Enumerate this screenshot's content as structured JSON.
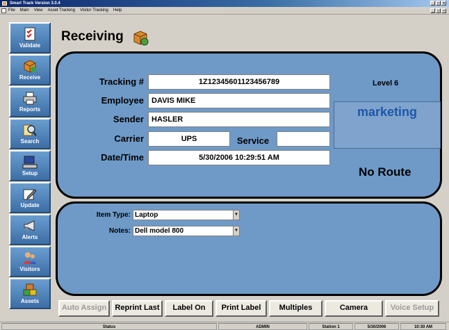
{
  "window": {
    "title": "Smart Track Version 3.0.4"
  },
  "menu": [
    "File",
    "Main",
    "View",
    "Asset Tracking",
    "Visitor Tracking",
    "Help"
  ],
  "window_controls": [
    "_",
    "□",
    "×"
  ],
  "sidebar": {
    "items": [
      {
        "label": "Validate",
        "icon": "checklist-icon"
      },
      {
        "label": "Receive",
        "icon": "package-icon"
      },
      {
        "label": "Reports",
        "icon": "printer-icon"
      },
      {
        "label": "Search",
        "icon": "magnifier-icon"
      },
      {
        "label": "Setup",
        "icon": "computer-icon"
      },
      {
        "label": "Update",
        "icon": "pencil-icon"
      },
      {
        "label": "Alerts",
        "icon": "megaphone-icon"
      },
      {
        "label": "Visitors",
        "icon": "people-icon"
      },
      {
        "label": "Assets",
        "icon": "boxes-icon"
      }
    ]
  },
  "page": {
    "title": "Receiving"
  },
  "form": {
    "tracking_label": "Tracking #",
    "tracking_value": "1Z12345601123456789",
    "employee_label": "Employee",
    "employee_value": "DAVIS MIKE",
    "sender_label": "Sender",
    "sender_value": "HASLER",
    "carrier_label": "Carrier",
    "carrier_value": "UPS",
    "service_label": "Service",
    "service_value": "",
    "datetime_label": "Date/Time",
    "datetime_value": "5/30/2006 10:29:51 AM"
  },
  "info": {
    "level": "Level 6",
    "department": "marketing",
    "route": "No Route"
  },
  "item": {
    "type_label": "Item Type:",
    "type_value": "Laptop",
    "notes_label": "Notes:",
    "notes_value": "Dell model 800"
  },
  "actions": [
    {
      "label": "Auto Assign",
      "enabled": false
    },
    {
      "label": "Reprint Last",
      "enabled": true
    },
    {
      "label": "Label On",
      "enabled": true
    },
    {
      "label": "Print Label",
      "enabled": true
    },
    {
      "label": "Multiples",
      "enabled": true
    },
    {
      "label": "Camera",
      "enabled": true
    },
    {
      "label": "Voice Setup",
      "enabled": false
    }
  ],
  "status": {
    "label": "Status",
    "user": "ADMIN",
    "station": "Station 1",
    "date": "5/30/2006",
    "time": "10:30 AM"
  },
  "colors": {
    "panel": "#6f9ac7",
    "sidebar_button": "#4a7db8",
    "department_text": "#1d57a8"
  }
}
